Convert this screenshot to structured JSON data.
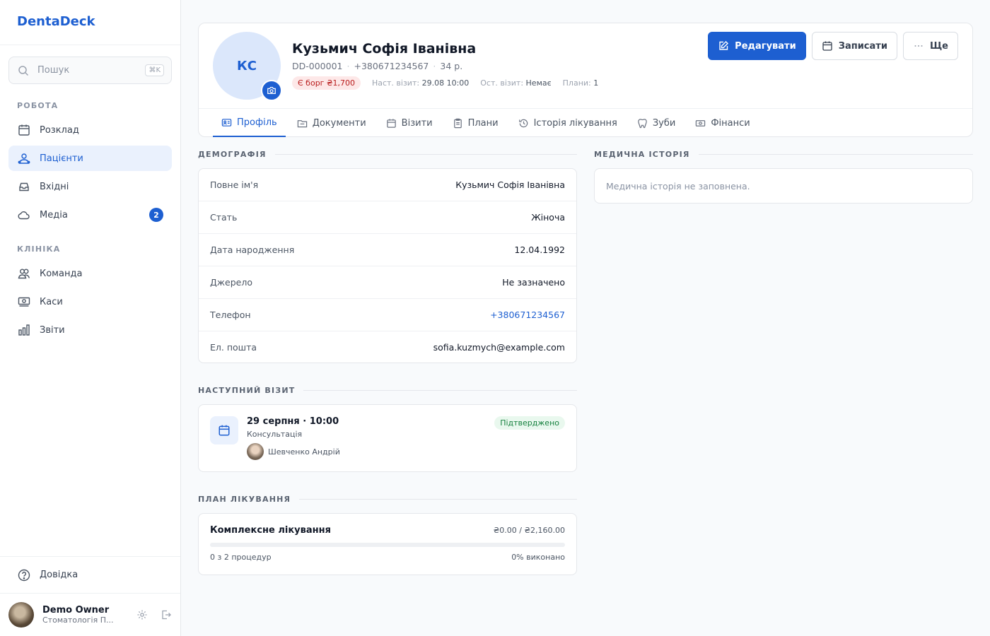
{
  "app": {
    "brand": "DentaDeck"
  },
  "sidebar": {
    "search_placeholder": "Пошук",
    "search_shortcut": "⌘K",
    "sections": {
      "work": "РОБОТА",
      "clinic": "КЛІНІКА"
    },
    "items": [
      {
        "label": "Розклад",
        "icon": "calendar-icon"
      },
      {
        "label": "Пацієнти",
        "icon": "users-icon",
        "active": true
      },
      {
        "label": "Вхідні",
        "icon": "inbox-icon"
      },
      {
        "label": "Медіа",
        "icon": "cloud-icon",
        "badge": "2"
      },
      {
        "label": "Команда",
        "icon": "team-icon"
      },
      {
        "label": "Каси",
        "icon": "cash-icon"
      },
      {
        "label": "Звіти",
        "icon": "chart-icon"
      }
    ],
    "help": "Довідка",
    "user": {
      "name": "Demo Owner",
      "org": "Стоматологія П..."
    }
  },
  "patient": {
    "initials": "КС",
    "name": "Кузьмич Софія Іванівна",
    "id": "DD-000001",
    "phone": "+380671234567",
    "age": "34 р.",
    "debt": "Є борг ₴1,700",
    "next_visit_label": "Наст. візит:",
    "next_visit_value": "29.08 10:00",
    "last_visit_label": "Ост. візит:",
    "last_visit_value": "Немає",
    "plans_label": "Плани:",
    "plans_value": "1"
  },
  "actions": {
    "edit": "Редагувати",
    "book": "Записати",
    "more": "Ще"
  },
  "tabs": [
    {
      "label": "Профіль",
      "active": true
    },
    {
      "label": "Документи"
    },
    {
      "label": "Візити"
    },
    {
      "label": "Плани"
    },
    {
      "label": "Історія лікування"
    },
    {
      "label": "Зуби"
    },
    {
      "label": "Фінанси"
    }
  ],
  "demographics": {
    "title": "ДЕМОГРАФІЯ",
    "rows": [
      {
        "k": "Повне ім'я",
        "v": "Кузьмич Софія Іванівна"
      },
      {
        "k": "Стать",
        "v": "Жіноча"
      },
      {
        "k": "Дата народження",
        "v": "12.04.1992"
      },
      {
        "k": "Джерело",
        "v": "Не зазначено"
      },
      {
        "k": "Телефон",
        "v": "+380671234567",
        "link": true
      },
      {
        "k": "Ел. пошта",
        "v": "sofia.kuzmych@example.com"
      }
    ]
  },
  "next_visit": {
    "title": "НАСТУПНИЙ ВІЗИТ",
    "datetime": "29 серпня · 10:00",
    "type": "Консультація",
    "doctor": "Шевченко Андрій",
    "status": "Підтверджено"
  },
  "treatment_plan": {
    "title": "ПЛАН ЛІКУВАННЯ",
    "name": "Комплексне лікування",
    "sum": "₴0.00 / ₴2,160.00",
    "progress": "0 з 2 процедур",
    "done": "0% виконано",
    "progress_fraction": 0
  },
  "medical_history": {
    "title": "МЕДИЧНА ІСТОРІЯ",
    "empty": "Медична історія не заповнена."
  },
  "colors": {
    "accent": "#1d5fd1",
    "danger": "#b91c1c",
    "success": "#15803d"
  }
}
